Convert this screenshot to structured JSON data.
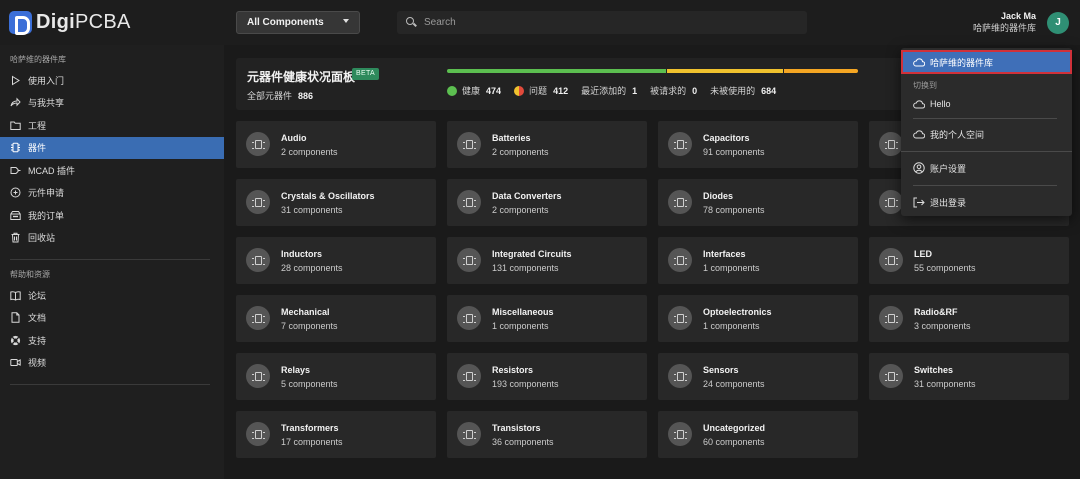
{
  "brand": {
    "name_bold": "Digi",
    "name_rest": "PCBA"
  },
  "header": {
    "filter_selected": "All Components",
    "search_placeholder": "Search",
    "user_name": "Jack Ma",
    "user_org": "哈萨维的器件库",
    "avatar_initial": "J"
  },
  "sidebar": {
    "section1_title": "哈萨维的器件库",
    "items1": [
      {
        "label": "使用入门",
        "icon": "play-icon"
      },
      {
        "label": "与我共享",
        "icon": "share-icon"
      },
      {
        "label": "工程",
        "icon": "folder-icon"
      },
      {
        "label": "器件",
        "icon": "component-icon",
        "active": true
      },
      {
        "label": "MCAD 插件",
        "icon": "plugin-icon"
      },
      {
        "label": "元件申请",
        "icon": "request-icon"
      },
      {
        "label": "我的订单",
        "icon": "orders-icon"
      },
      {
        "label": "回收站",
        "icon": "trash-icon"
      }
    ],
    "section2_title": "帮助和资源",
    "items2": [
      {
        "label": "论坛",
        "icon": "book-icon"
      },
      {
        "label": "文档",
        "icon": "document-icon"
      },
      {
        "label": "支持",
        "icon": "lifebuoy-icon"
      },
      {
        "label": "视频",
        "icon": "video-icon"
      }
    ]
  },
  "health": {
    "title": "元器件健康状况面板",
    "badge": "BETA",
    "total_label": "全部元器件",
    "total_value": "886",
    "stats": {
      "healthy_label": "健康",
      "healthy_value": "474",
      "issues_label": "问题",
      "issues_value": "412",
      "recent_label": "最近添加的",
      "recent_value": "1",
      "requested_label": "被请求的",
      "requested_value": "0",
      "unused_label": "未被使用的",
      "unused_value": "684"
    },
    "bar_fractions": {
      "healthy": 0.535,
      "warning": 0.285,
      "issues": 0.18
    },
    "colors": {
      "healthy": "#5cbf50",
      "warning": "#f0c22e",
      "issues": "#f5a623"
    }
  },
  "categories": [
    {
      "name": "Audio",
      "count": "2 components"
    },
    {
      "name": "Batteries",
      "count": "2 components"
    },
    {
      "name": "Capacitors",
      "count": "91 components"
    },
    {
      "name": "",
      "count": ""
    },
    {
      "name": "Crystals & Oscillators",
      "count": "31 components"
    },
    {
      "name": "Data Converters",
      "count": "2 components"
    },
    {
      "name": "Diodes",
      "count": "78 components"
    },
    {
      "name": "",
      "count": ""
    },
    {
      "name": "Inductors",
      "count": "28 components"
    },
    {
      "name": "Integrated Circuits",
      "count": "131 components"
    },
    {
      "name": "Interfaces",
      "count": "1 components"
    },
    {
      "name": "LED",
      "count": "55 components"
    },
    {
      "name": "Mechanical",
      "count": "7 components"
    },
    {
      "name": "Miscellaneous",
      "count": "1 components"
    },
    {
      "name": "Optoelectronics",
      "count": "1 components"
    },
    {
      "name": "Radio&RF",
      "count": "3 components"
    },
    {
      "name": "Relays",
      "count": "5 components"
    },
    {
      "name": "Resistors",
      "count": "193 components"
    },
    {
      "name": "Sensors",
      "count": "24 components"
    },
    {
      "name": "Switches",
      "count": "31 components"
    },
    {
      "name": "Transformers",
      "count": "17 components"
    },
    {
      "name": "Transistors",
      "count": "36 components"
    },
    {
      "name": "Uncategorized",
      "count": "60 components"
    }
  ],
  "account_menu": {
    "current_library": "哈萨维的器件库",
    "switch_to_label": "切换到",
    "options": [
      "Hello",
      "我的个人空间"
    ],
    "settings_label": "账户设置",
    "logout_label": "退出登录"
  }
}
